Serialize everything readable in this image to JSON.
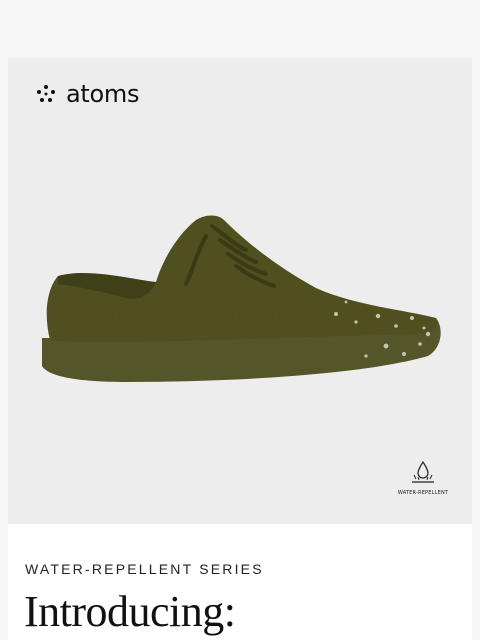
{
  "brand": {
    "name": "atoms",
    "logo_icon": "atoms-dots-logo"
  },
  "hero": {
    "product_image": "olive-green-knit-sneaker",
    "product_color": "#4f4f1f",
    "badge": {
      "icon": "water-drop-icon",
      "label": "WATER-REPELLENT"
    }
  },
  "content": {
    "eyebrow": "WATER-REPELLENT SERIES",
    "headline": "Introducing:"
  }
}
